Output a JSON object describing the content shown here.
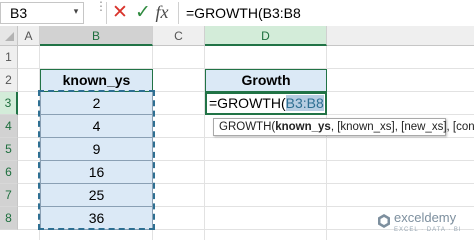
{
  "formula_bar": {
    "name_box": "B3",
    "cancel_icon": "✕",
    "enter_icon": "✓",
    "fx_label": "fx",
    "formula": "=GROWTH(B3:B8"
  },
  "columns": [
    "A",
    "B",
    "C",
    "D"
  ],
  "rows": [
    "1",
    "2",
    "3",
    "4",
    "5",
    "6",
    "7",
    "8"
  ],
  "table": {
    "header": "known_ys",
    "values": [
      "2",
      "4",
      "9",
      "16",
      "25",
      "36"
    ]
  },
  "growth": {
    "header": "Growth",
    "edit_prefix": "=GROWTH(",
    "edit_ref": "B3:B8"
  },
  "tooltip": {
    "fn": "GROWTH(",
    "arg_bold": "known_ys",
    "rest": ", [known_xs], [new_xs], [const])"
  },
  "watermark": {
    "name": "exceldemy",
    "tagline": "EXCEL · DATA · BI"
  },
  "colors": {
    "excel_green": "#217346",
    "table_fill": "#dbe9f6",
    "reference_blue": "#2e6f92",
    "cancel_red": "#d9332b",
    "enter_green": "#2f8a3f"
  }
}
